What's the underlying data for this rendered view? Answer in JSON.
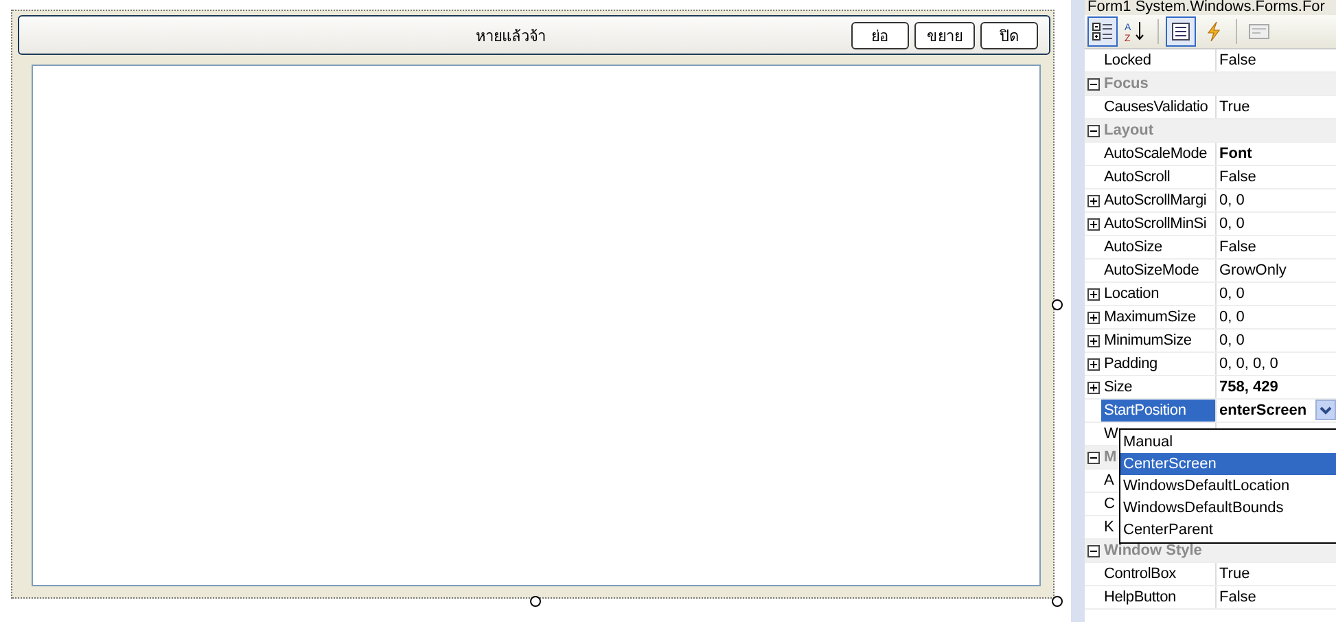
{
  "designer": {
    "form_title": "หายแล้วจ้า",
    "buttons": [
      "ย่อ",
      "ขยาย",
      "ปิด"
    ]
  },
  "properties": {
    "header": "Form1  System.Windows.Forms.For",
    "toolbar": [
      {
        "kind": "categorized",
        "selected": true
      },
      {
        "kind": "alphabetical",
        "selected": false,
        "glyphs": [
          "A",
          "Z"
        ]
      },
      {
        "kind": "separator"
      },
      {
        "kind": "properties",
        "selected": true
      },
      {
        "kind": "events",
        "selected": false
      },
      {
        "kind": "separator"
      },
      {
        "kind": "pages",
        "selected": false
      }
    ],
    "rows": [
      {
        "kind": "property",
        "name": "Locked",
        "value": "False",
        "expandable": false,
        "modified": false,
        "selected": false
      },
      {
        "kind": "category",
        "name": "Focus",
        "expanded": true
      },
      {
        "kind": "property",
        "name": "CausesValidatio",
        "value": "True",
        "expandable": false,
        "modified": false,
        "selected": false
      },
      {
        "kind": "category",
        "name": "Layout",
        "expanded": true
      },
      {
        "kind": "property",
        "name": "AutoScaleMode",
        "value": "Font",
        "expandable": false,
        "modified": true,
        "selected": false
      },
      {
        "kind": "property",
        "name": "AutoScroll",
        "value": "False",
        "expandable": false,
        "modified": false,
        "selected": false
      },
      {
        "kind": "property",
        "name": "AutoScrollMargi",
        "value": "0, 0",
        "expandable": true,
        "modified": false,
        "selected": false
      },
      {
        "kind": "property",
        "name": "AutoScrollMinSi",
        "value": "0, 0",
        "expandable": true,
        "modified": false,
        "selected": false
      },
      {
        "kind": "property",
        "name": "AutoSize",
        "value": "False",
        "expandable": false,
        "modified": false,
        "selected": false
      },
      {
        "kind": "property",
        "name": "AutoSizeMode",
        "value": "GrowOnly",
        "expandable": false,
        "modified": false,
        "selected": false
      },
      {
        "kind": "property",
        "name": "Location",
        "value": "0, 0",
        "expandable": true,
        "modified": false,
        "selected": false
      },
      {
        "kind": "property",
        "name": "MaximumSize",
        "value": "0, 0",
        "expandable": true,
        "modified": false,
        "selected": false
      },
      {
        "kind": "property",
        "name": "MinimumSize",
        "value": "0, 0",
        "expandable": true,
        "modified": false,
        "selected": false
      },
      {
        "kind": "property",
        "name": "Padding",
        "value": "0, 0, 0, 0",
        "expandable": true,
        "modified": false,
        "selected": false
      },
      {
        "kind": "property",
        "name": "Size",
        "value": "758, 429",
        "expandable": true,
        "modified": true,
        "selected": false
      },
      {
        "kind": "property",
        "name": "StartPosition",
        "value": "enterScreen",
        "expandable": false,
        "modified": true,
        "selected": true
      },
      {
        "kind": "property",
        "name": "W",
        "expandable": false,
        "selected": false
      },
      {
        "kind": "category",
        "name": "M",
        "expanded": true
      },
      {
        "kind": "property",
        "name": "A",
        "expandable": false,
        "selected": false
      },
      {
        "kind": "property",
        "name": "C",
        "expandable": false,
        "selected": false
      },
      {
        "kind": "property",
        "name": "K",
        "expandable": false,
        "selected": false
      },
      {
        "kind": "category",
        "name": "Window Style",
        "expanded": true
      },
      {
        "kind": "property",
        "name": "ControlBox",
        "value": "True",
        "expandable": false,
        "modified": false,
        "selected": false
      },
      {
        "kind": "property",
        "name": "HelpButton",
        "value": "False",
        "expandable": false,
        "modified": false,
        "selected": false
      }
    ],
    "dropdown": [
      {
        "label": "Manual",
        "selected": false
      },
      {
        "label": "CenterScreen",
        "selected": true
      },
      {
        "label": "WindowsDefaultLocation",
        "selected": false
      },
      {
        "label": "WindowsDefaultBounds",
        "selected": false
      },
      {
        "label": "CenterParent",
        "selected": false
      }
    ]
  }
}
